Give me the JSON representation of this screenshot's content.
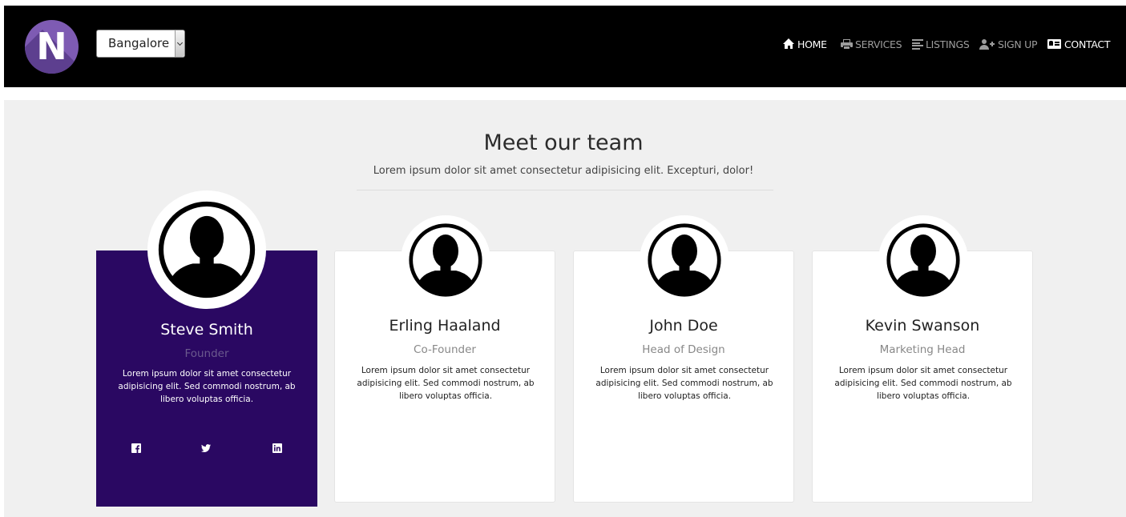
{
  "header": {
    "logo_letter": "N",
    "city_select": {
      "selected": "Bangalore"
    },
    "nav": [
      {
        "label": "HOME",
        "icon": "home-icon",
        "active": true
      },
      {
        "label": "SERVICES",
        "icon": "print-icon",
        "active": false
      },
      {
        "label": "LISTINGS",
        "icon": "list-icon",
        "active": false
      },
      {
        "label": "SIGN UP",
        "icon": "user-plus-icon",
        "active": false
      },
      {
        "label": "CONTACT",
        "icon": "contact-card-icon",
        "active": true
      }
    ]
  },
  "team": {
    "title": "Meet our team",
    "subtitle": "Lorem ipsum dolor sit amet consectetur adipisicing elit. Excepturi, dolor!",
    "members": [
      {
        "name": "Steve Smith",
        "role": "Founder",
        "bio": "Lorem ipsum dolor sit amet consectetur adipisicing elit. Sed commodi nostrum, ab libero voluptas officia.",
        "featured": true,
        "social": [
          "facebook-icon",
          "twitter-icon",
          "linkedin-icon"
        ]
      },
      {
        "name": "Erling Haaland",
        "role": "Co-Founder",
        "bio": "Lorem ipsum dolor sit amet consectetur adipisicing elit. Sed commodi nostrum, ab libero voluptas officia.",
        "featured": false
      },
      {
        "name": "John Doe",
        "role": "Head of Design",
        "bio": "Lorem ipsum dolor sit amet consectetur adipisicing elit. Sed commodi nostrum, ab libero voluptas officia.",
        "featured": false
      },
      {
        "name": "Kevin Swanson",
        "role": "Marketing Head",
        "bio": "Lorem ipsum dolor sit amet consectetur adipisicing elit. Sed commodi nostrum, ab libero voluptas officia.",
        "featured": false
      }
    ]
  },
  "colors": {
    "navbar_bg": "#000000",
    "logo_bg": "#7e5bb3",
    "section_bg": "#f0f0f0",
    "featured_card_bg": "#2a0862",
    "nav_muted": "#9d9d9d"
  }
}
